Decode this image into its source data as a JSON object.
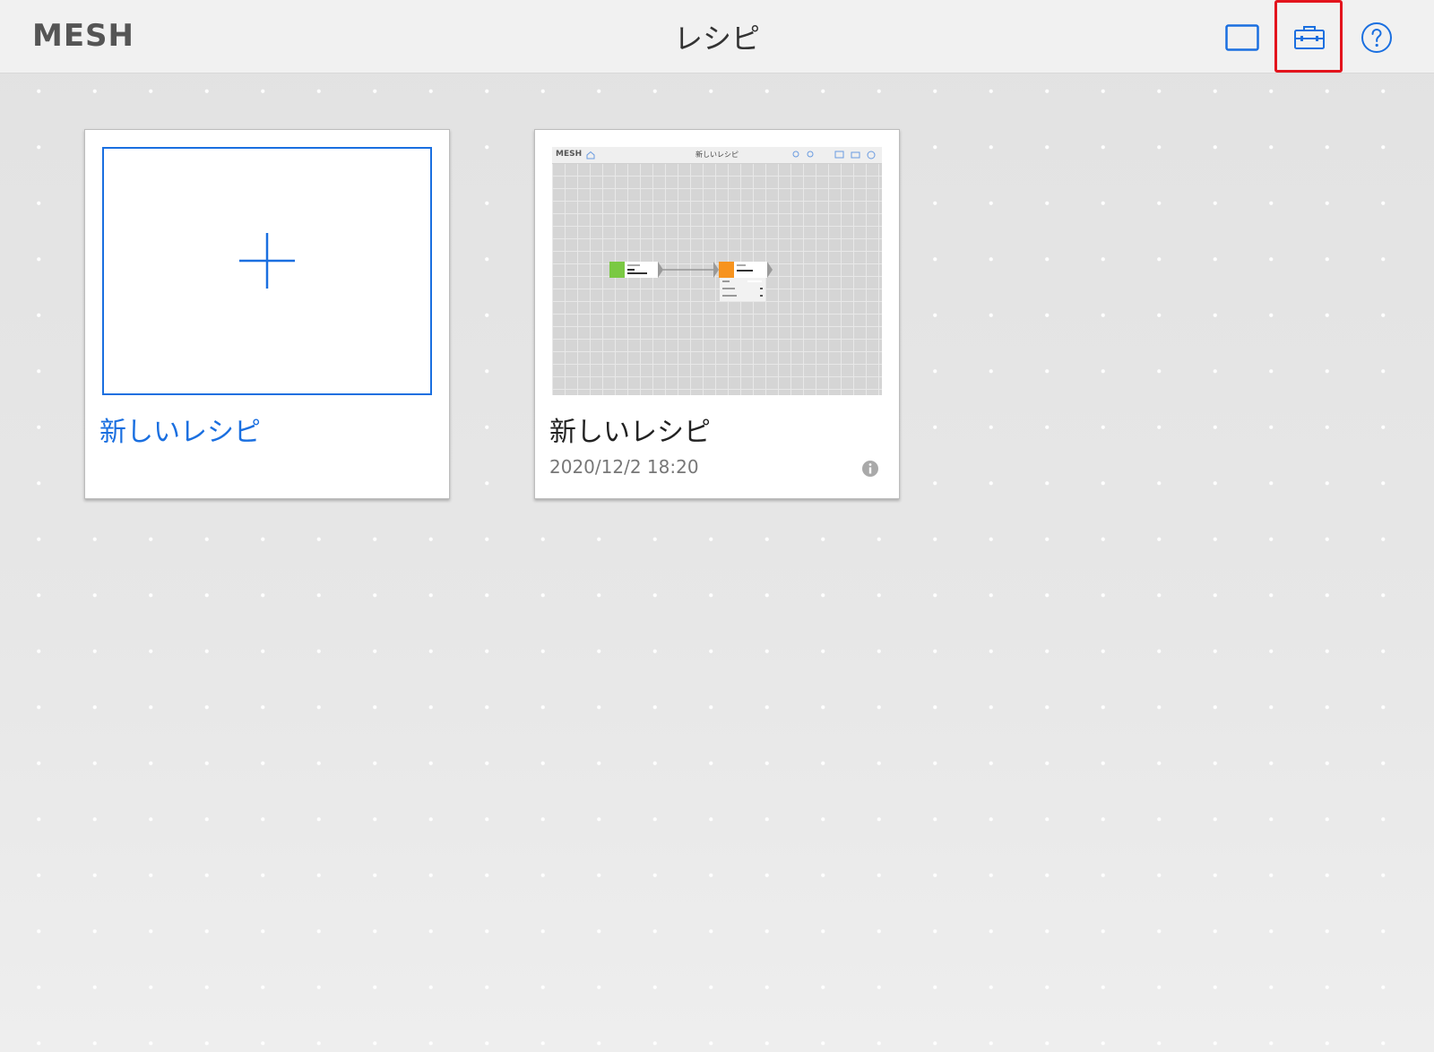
{
  "header": {
    "logo": "MESH",
    "title": "レシピ",
    "icons": [
      "frame-icon",
      "toolbox-icon",
      "help-icon"
    ],
    "accent_color": "#1a6fe0",
    "highlight_color": "#e3141d"
  },
  "cards": {
    "new_recipe": {
      "label": "新しいレシピ",
      "icon": "plus-icon"
    },
    "recipe": {
      "title": "新しいレシピ",
      "date": "2020/12/2 18:20",
      "icon": "info-icon",
      "thumbnail": {
        "logo": "MESH",
        "title": "新しいレシピ"
      }
    }
  }
}
